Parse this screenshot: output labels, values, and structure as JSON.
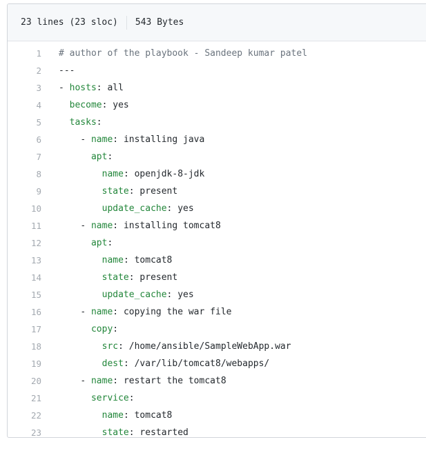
{
  "header": {
    "lines_info": "23 lines (23 sloc)",
    "size_info": "543 Bytes"
  },
  "lines": [
    {
      "num": "1",
      "indent": "",
      "parts": [
        {
          "cls": "comment",
          "text": "# author of the playbook - Sandeep kumar patel"
        }
      ]
    },
    {
      "num": "2",
      "indent": "",
      "parts": [
        {
          "cls": "punct",
          "text": "---"
        }
      ]
    },
    {
      "num": "3",
      "indent": "",
      "parts": [
        {
          "cls": "punct",
          "text": "- "
        },
        {
          "cls": "key",
          "text": "hosts"
        },
        {
          "cls": "punct",
          "text": ": "
        },
        {
          "cls": "val",
          "text": "all"
        }
      ]
    },
    {
      "num": "4",
      "indent": "  ",
      "parts": [
        {
          "cls": "key",
          "text": "become"
        },
        {
          "cls": "punct",
          "text": ": "
        },
        {
          "cls": "val",
          "text": "yes"
        }
      ]
    },
    {
      "num": "5",
      "indent": "  ",
      "parts": [
        {
          "cls": "key",
          "text": "tasks"
        },
        {
          "cls": "punct",
          "text": ":"
        }
      ]
    },
    {
      "num": "6",
      "indent": "    ",
      "parts": [
        {
          "cls": "punct",
          "text": "- "
        },
        {
          "cls": "key",
          "text": "name"
        },
        {
          "cls": "punct",
          "text": ": "
        },
        {
          "cls": "val",
          "text": "installing java"
        }
      ]
    },
    {
      "num": "7",
      "indent": "      ",
      "parts": [
        {
          "cls": "key",
          "text": "apt"
        },
        {
          "cls": "punct",
          "text": ":"
        }
      ]
    },
    {
      "num": "8",
      "indent": "        ",
      "parts": [
        {
          "cls": "key",
          "text": "name"
        },
        {
          "cls": "punct",
          "text": ": "
        },
        {
          "cls": "val",
          "text": "openjdk-8-jdk"
        }
      ]
    },
    {
      "num": "9",
      "indent": "        ",
      "parts": [
        {
          "cls": "key",
          "text": "state"
        },
        {
          "cls": "punct",
          "text": ": "
        },
        {
          "cls": "val",
          "text": "present"
        }
      ]
    },
    {
      "num": "10",
      "indent": "        ",
      "parts": [
        {
          "cls": "key",
          "text": "update_cache"
        },
        {
          "cls": "punct",
          "text": ": "
        },
        {
          "cls": "val",
          "text": "yes"
        }
      ]
    },
    {
      "num": "11",
      "indent": "    ",
      "parts": [
        {
          "cls": "punct",
          "text": "- "
        },
        {
          "cls": "key",
          "text": "name"
        },
        {
          "cls": "punct",
          "text": ": "
        },
        {
          "cls": "val",
          "text": "installing tomcat8"
        }
      ]
    },
    {
      "num": "12",
      "indent": "      ",
      "parts": [
        {
          "cls": "key",
          "text": "apt"
        },
        {
          "cls": "punct",
          "text": ":"
        }
      ]
    },
    {
      "num": "13",
      "indent": "        ",
      "parts": [
        {
          "cls": "key",
          "text": "name"
        },
        {
          "cls": "punct",
          "text": ": "
        },
        {
          "cls": "val",
          "text": "tomcat8"
        }
      ]
    },
    {
      "num": "14",
      "indent": "        ",
      "parts": [
        {
          "cls": "key",
          "text": "state"
        },
        {
          "cls": "punct",
          "text": ": "
        },
        {
          "cls": "val",
          "text": "present"
        }
      ]
    },
    {
      "num": "15",
      "indent": "        ",
      "parts": [
        {
          "cls": "key",
          "text": "update_cache"
        },
        {
          "cls": "punct",
          "text": ": "
        },
        {
          "cls": "val",
          "text": "yes"
        }
      ]
    },
    {
      "num": "16",
      "indent": "    ",
      "parts": [
        {
          "cls": "punct",
          "text": "- "
        },
        {
          "cls": "key",
          "text": "name"
        },
        {
          "cls": "punct",
          "text": ": "
        },
        {
          "cls": "val",
          "text": "copying the war file"
        }
      ]
    },
    {
      "num": "17",
      "indent": "      ",
      "parts": [
        {
          "cls": "key",
          "text": "copy"
        },
        {
          "cls": "punct",
          "text": ":"
        }
      ]
    },
    {
      "num": "18",
      "indent": "        ",
      "parts": [
        {
          "cls": "key",
          "text": "src"
        },
        {
          "cls": "punct",
          "text": ": "
        },
        {
          "cls": "val",
          "text": "/home/ansible/SampleWebApp.war"
        }
      ]
    },
    {
      "num": "19",
      "indent": "        ",
      "parts": [
        {
          "cls": "key",
          "text": "dest"
        },
        {
          "cls": "punct",
          "text": ": "
        },
        {
          "cls": "val",
          "text": "/var/lib/tomcat8/webapps/"
        }
      ]
    },
    {
      "num": "20",
      "indent": "    ",
      "parts": [
        {
          "cls": "punct",
          "text": "- "
        },
        {
          "cls": "key",
          "text": "name"
        },
        {
          "cls": "punct",
          "text": ": "
        },
        {
          "cls": "val",
          "text": "restart the tomcat8"
        }
      ]
    },
    {
      "num": "21",
      "indent": "      ",
      "parts": [
        {
          "cls": "key",
          "text": "service"
        },
        {
          "cls": "punct",
          "text": ":"
        }
      ]
    },
    {
      "num": "22",
      "indent": "        ",
      "parts": [
        {
          "cls": "key",
          "text": "name"
        },
        {
          "cls": "punct",
          "text": ": "
        },
        {
          "cls": "val",
          "text": "tomcat8"
        }
      ]
    },
    {
      "num": "23",
      "indent": "        ",
      "parts": [
        {
          "cls": "key",
          "text": "state"
        },
        {
          "cls": "punct",
          "text": ": "
        },
        {
          "cls": "val",
          "text": "restarted"
        }
      ]
    }
  ]
}
